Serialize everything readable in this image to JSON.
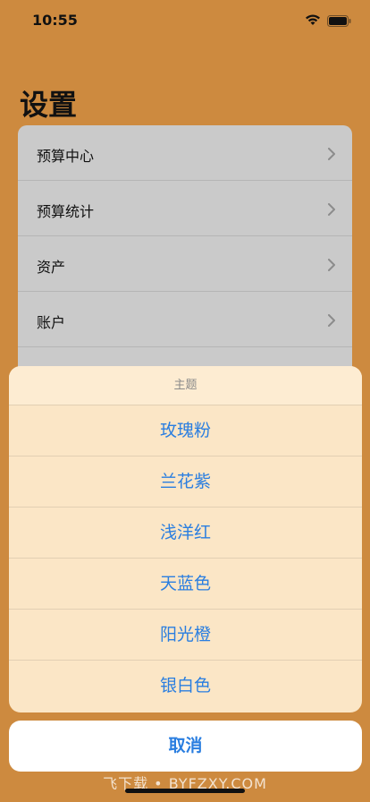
{
  "status_bar": {
    "time": "10:55"
  },
  "page": {
    "title": "设置"
  },
  "settings": {
    "items": [
      {
        "label": "预算中心"
      },
      {
        "label": "预算统计"
      },
      {
        "label": "资产"
      },
      {
        "label": "账户"
      },
      {
        "label": ""
      }
    ]
  },
  "action_sheet": {
    "title": "主题",
    "options": [
      {
        "label": "玫瑰粉"
      },
      {
        "label": "兰花紫"
      },
      {
        "label": "浅洋红"
      },
      {
        "label": "天蓝色"
      },
      {
        "label": "阳光橙"
      },
      {
        "label": "银白色"
      }
    ],
    "cancel_label": "取消"
  },
  "watermark": "飞下载 • BYFZXY.COM",
  "colors": {
    "background": "#cd8a3f",
    "card": "#cacaca",
    "sheet": "#fbe6c6",
    "accent": "#2a7ee0"
  }
}
